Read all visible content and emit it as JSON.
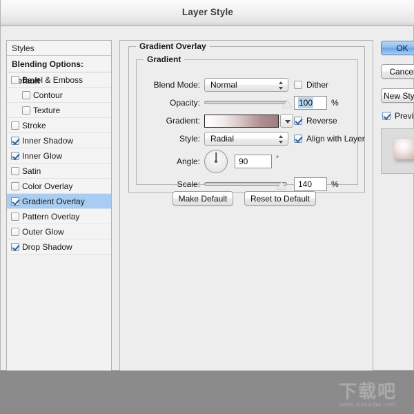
{
  "window": {
    "title": "Layer Style"
  },
  "styles_panel": {
    "header": "Styles",
    "blending_options": "Blending Options: Default",
    "items": [
      {
        "label": "Bevel & Emboss",
        "checked": false,
        "indent": false,
        "selected": false
      },
      {
        "label": "Contour",
        "checked": false,
        "indent": true,
        "selected": false
      },
      {
        "label": "Texture",
        "checked": false,
        "indent": true,
        "selected": false
      },
      {
        "label": "Stroke",
        "checked": false,
        "indent": false,
        "selected": false
      },
      {
        "label": "Inner Shadow",
        "checked": true,
        "indent": false,
        "selected": false
      },
      {
        "label": "Inner Glow",
        "checked": true,
        "indent": false,
        "selected": false
      },
      {
        "label": "Satin",
        "checked": false,
        "indent": false,
        "selected": false
      },
      {
        "label": "Color Overlay",
        "checked": false,
        "indent": false,
        "selected": false
      },
      {
        "label": "Gradient Overlay",
        "checked": true,
        "indent": false,
        "selected": true
      },
      {
        "label": "Pattern Overlay",
        "checked": false,
        "indent": false,
        "selected": false
      },
      {
        "label": "Outer Glow",
        "checked": false,
        "indent": false,
        "selected": false
      },
      {
        "label": "Drop Shadow",
        "checked": true,
        "indent": false,
        "selected": false
      }
    ]
  },
  "main": {
    "group_title": "Gradient Overlay",
    "subgroup_title": "Gradient",
    "blend_mode": {
      "label": "Blend Mode:",
      "value": "Normal"
    },
    "dither": {
      "label": "Dither",
      "checked": false
    },
    "opacity": {
      "label": "Opacity:",
      "value": "100",
      "unit": "%",
      "percent": 100
    },
    "gradient": {
      "label": "Gradient:",
      "stops": [
        "#ffffff",
        "#f2eceb",
        "#d6c3c1",
        "#b09192",
        "#9d7d80"
      ]
    },
    "reverse": {
      "label": "Reverse",
      "checked": true
    },
    "style": {
      "label": "Style:",
      "value": "Radial"
    },
    "align_with_layer": {
      "label": "Align with Layer",
      "checked": true
    },
    "angle": {
      "label": "Angle:",
      "value": "90",
      "unit": "°",
      "degrees": 90
    },
    "scale": {
      "label": "Scale:",
      "value": "140",
      "unit": "%",
      "percent": 140
    },
    "make_default": "Make Default",
    "reset_to_default": "Reset to Default"
  },
  "right": {
    "ok": "OK",
    "cancel": "Cancel",
    "new_style": "New Style...",
    "preview": {
      "label": "Preview",
      "checked": true
    }
  },
  "watermark": {
    "logo": "下载吧",
    "url": "www.xiazaiba.com"
  },
  "colors": {
    "accent_blue": "#a9cdf2",
    "check_blue": "#2b5b96",
    "window_bg": "#ededed",
    "desktop_bg": "#8b8b8b"
  }
}
